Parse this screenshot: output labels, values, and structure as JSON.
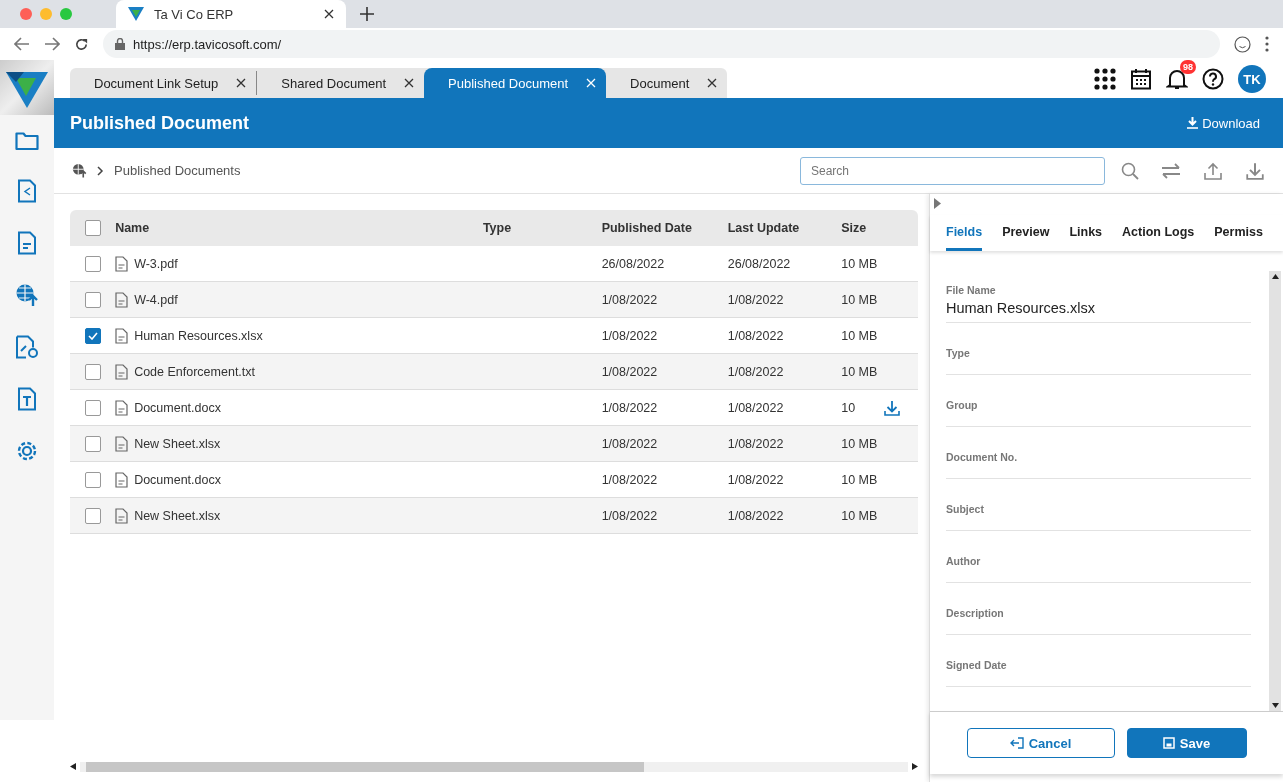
{
  "browser": {
    "tab_title": "Ta Vi Co ERP",
    "url": "https://erp.tavicosoft.com/"
  },
  "app_tabs": [
    {
      "label": "Document Link Setup",
      "selected": false
    },
    {
      "label": "Shared Document",
      "selected": false
    },
    {
      "label": "Published Document",
      "selected": true
    },
    {
      "label": "Document",
      "selected": false
    }
  ],
  "notifications": {
    "count": "98"
  },
  "user": {
    "initials": "TK"
  },
  "header": {
    "title": "Published Document",
    "action": "Download"
  },
  "breadcrumb": [
    "Published Documents"
  ],
  "search": {
    "placeholder": "Search"
  },
  "table": {
    "columns": [
      "Name",
      "Type",
      "Published Date",
      "Last Update",
      "Size"
    ],
    "all_checked": false,
    "rows": [
      {
        "checked": false,
        "name": "W-3.pdf",
        "published": "26/08/2022",
        "updated": "26/08/2022",
        "size": "10 MB",
        "download_icon": false
      },
      {
        "checked": false,
        "name": "W-4.pdf",
        "published": "1/08/2022",
        "updated": "1/08/2022",
        "size": "10 MB",
        "download_icon": false
      },
      {
        "checked": true,
        "name": "Human Resources.xlsx",
        "published": "1/08/2022",
        "updated": "1/08/2022",
        "size": "10 MB",
        "download_icon": false
      },
      {
        "checked": false,
        "name": "Code Enforcement.txt",
        "published": "1/08/2022",
        "updated": "1/08/2022",
        "size": "10 MB",
        "download_icon": false
      },
      {
        "checked": false,
        "name": "Document.docx",
        "published": "1/08/2022",
        "updated": "1/08/2022",
        "size": "10",
        "download_icon": true
      },
      {
        "checked": false,
        "name": "New Sheet.xlsx",
        "published": "1/08/2022",
        "updated": "1/08/2022",
        "size": "10 MB",
        "download_icon": false
      },
      {
        "checked": false,
        "name": "Document.docx",
        "published": "1/08/2022",
        "updated": "1/08/2022",
        "size": "10 MB",
        "download_icon": false
      },
      {
        "checked": false,
        "name": "New Sheet.xlsx",
        "published": "1/08/2022",
        "updated": "1/08/2022",
        "size": "10 MB",
        "download_icon": false
      }
    ]
  },
  "panel_tabs": [
    {
      "label": "Fields",
      "selected": true
    },
    {
      "label": "Preview",
      "selected": false
    },
    {
      "label": "Links",
      "selected": false
    },
    {
      "label": "Action Logs",
      "selected": false
    },
    {
      "label": "Permiss",
      "selected": false
    }
  ],
  "fields": [
    {
      "label": "File Name",
      "value": "Human Resources.xlsx"
    },
    {
      "label": "Type"
    },
    {
      "label": "Group"
    },
    {
      "label": "Document No."
    },
    {
      "label": "Subject"
    },
    {
      "label": "Author"
    },
    {
      "label": "Description"
    },
    {
      "label": "Signed Date"
    }
  ],
  "buttons": {
    "cancel": "Cancel",
    "save": "Save"
  }
}
